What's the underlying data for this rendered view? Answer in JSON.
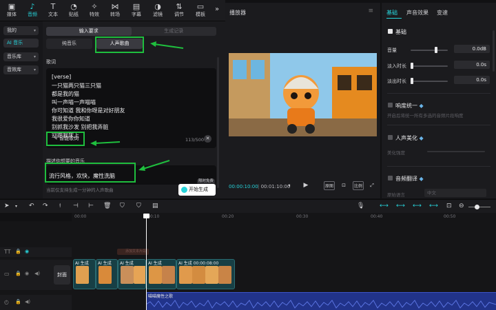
{
  "toolbar": {
    "items": [
      {
        "label": "媒体",
        "icon": "media-icon",
        "glyph": "▣"
      },
      {
        "label": "音频",
        "icon": "audio-icon",
        "glyph": "♪"
      },
      {
        "label": "文本",
        "icon": "text-icon",
        "glyph": "T"
      },
      {
        "label": "贴纸",
        "icon": "sticker-icon",
        "glyph": "◔"
      },
      {
        "label": "特效",
        "icon": "effects-icon",
        "glyph": "✧"
      },
      {
        "label": "转场",
        "icon": "transition-icon",
        "glyph": "⋈"
      },
      {
        "label": "字幕",
        "icon": "caption-icon",
        "glyph": "▤"
      },
      {
        "label": "滤镜",
        "icon": "filter-icon",
        "glyph": "◑"
      },
      {
        "label": "调节",
        "icon": "adjust-icon",
        "glyph": "⇅"
      },
      {
        "label": "模板",
        "icon": "template-icon",
        "glyph": "▭"
      }
    ],
    "more": "»"
  },
  "categories": {
    "items": [
      {
        "label": "我的"
      },
      {
        "label": "AI 音乐"
      },
      {
        "label": "音乐库"
      },
      {
        "label": "音效库"
      }
    ]
  },
  "gen": {
    "tab_input": "输入要求",
    "tab_records": "生成记录",
    "sub_pure": "纯音乐",
    "sub_vocal": "人声歌曲",
    "lyrics_label": "歌词",
    "lyrics_lines": [
      "[verse]",
      "一只猫两只猫三只猫",
      "都是我的猫",
      "叫一声喵一声喵喵",
      "你可知道 我和你呀是对好朋友",
      "我很爱你你知道",
      "别抓我沙发 别把我弄脏",
      "别跑我床上"
    ],
    "smart_lyrics": "智能歌词",
    "counter": "113/500",
    "clear": "✕",
    "desc_label": "描述你想要的音乐",
    "desc_value": "流行风格，欢快，魔性洗脑",
    "hint": "当前仅支持生成一分钟的人声歌曲",
    "generate": "开始生成",
    "limited": "限时免费"
  },
  "player": {
    "title": "播放器",
    "menu": "≡",
    "time_current": "00:00:10:00",
    "time_total": "00:01:10:00",
    "buttons": [
      "⏸",
      "▶",
      "原图",
      "⊡",
      "比例",
      "⤢"
    ]
  },
  "props": {
    "tabs": [
      "基础",
      "声音效果",
      "变速"
    ],
    "basic": "基础",
    "volume_label": "音量",
    "volume_value": "0.0dB",
    "volume_level": 0.65,
    "fadein_label": "淡入时长",
    "fadein_value": "0.0s",
    "fadeout_label": "淡出时长",
    "fadeout_value": "0.0s",
    "loudness": "响度统一",
    "loudness_desc": "开启后将统一所有多选的音频片段响度",
    "enhance": "人声美化",
    "enhance_label": "美化强度",
    "translate": "音频翻译",
    "translate_src": "原始语言",
    "translate_value": "中文"
  },
  "timeline": {
    "ruler": [
      "00:00",
      "00:10",
      "00:20",
      "00:30",
      "00:40",
      "00:50"
    ],
    "cover": "封面",
    "clip_label": "AI 生成",
    "last_clip_label": "AI 生成  00:00:08:00",
    "audio_label": "喵喵魔性之歌",
    "subtitle_ghost": "添加文本片段"
  }
}
